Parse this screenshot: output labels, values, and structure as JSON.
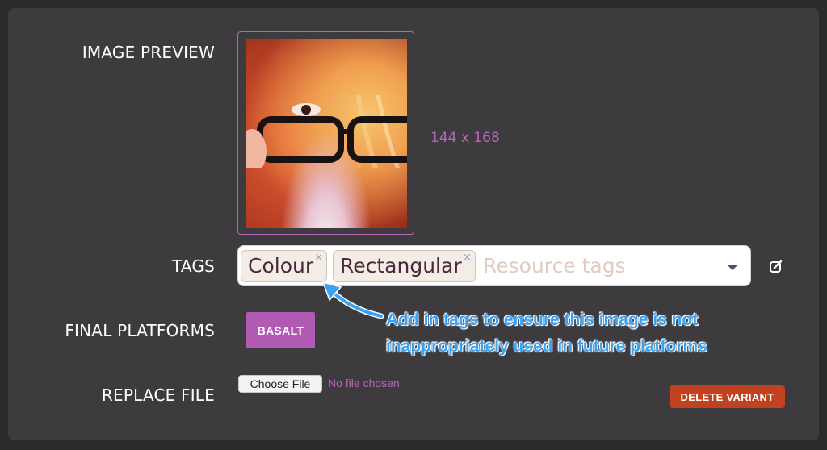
{
  "labels": {
    "image_preview": "IMAGE PREVIEW",
    "tags": "TAGS",
    "final_platforms": "FINAL PLATFORMS",
    "replace_file": "REPLACE FILE"
  },
  "preview": {
    "dimensions": "144 x 168"
  },
  "tags": {
    "items": [
      {
        "label": "Colour",
        "remove": "×"
      },
      {
        "label": "Rectangular",
        "remove": "×"
      }
    ],
    "placeholder": "Resource tags",
    "icons": {
      "dropdown": "caret-down-icon",
      "edit": "edit-icon"
    }
  },
  "platforms": {
    "items": [
      "BASALT"
    ],
    "color": "#b05ab4"
  },
  "annotation": {
    "line1": "Add in tags to ensure this image is not",
    "line2": "inappropriately used in future platforms",
    "color": "#3aa2f2"
  },
  "replace_file": {
    "button": "Choose File",
    "status": "No file chosen"
  },
  "actions": {
    "delete": "DELETE VARIANT",
    "delete_color": "#c2411f"
  },
  "colors": {
    "background": "#3e3b3f",
    "accent": "#b666b6"
  }
}
